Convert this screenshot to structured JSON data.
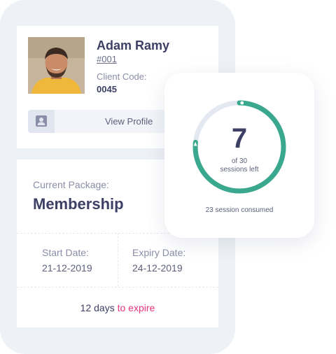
{
  "client": {
    "name": "Adam Ramy",
    "id": "#001",
    "code_label": "Client Code:",
    "code": "0045",
    "view_profile_label": "View Profile"
  },
  "package": {
    "label": "Current Package:",
    "name": "Membership",
    "start_label": "Start Date:",
    "start_date": "21-12-2019",
    "expiry_label": "Expiry Date:",
    "expiry_date": "24-12-2019",
    "days_left": "12 days",
    "expire_text": "to expire"
  },
  "sessions": {
    "left": "7",
    "of_text": "of 30",
    "left_label": "sessions left",
    "consumed_text": "23 session consumed",
    "total": 30,
    "consumed": 23
  },
  "colors": {
    "accent": "#3aa88e",
    "track": "#e3e8f1",
    "text_dark": "#3d3f64",
    "pink": "#e5357d"
  },
  "icons": {
    "profile_icon": "contact-card-icon"
  }
}
